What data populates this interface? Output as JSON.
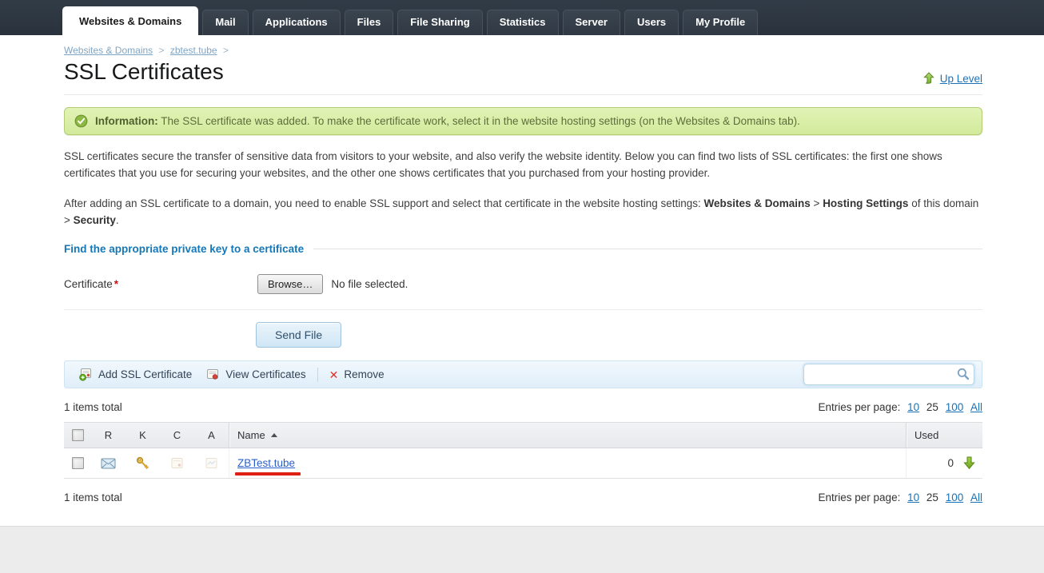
{
  "nav": {
    "tabs": [
      {
        "label": "Websites & Domains",
        "active": true
      },
      {
        "label": "Mail",
        "active": false
      },
      {
        "label": "Applications",
        "active": false
      },
      {
        "label": "Files",
        "active": false
      },
      {
        "label": "File Sharing",
        "active": false
      },
      {
        "label": "Statistics",
        "active": false
      },
      {
        "label": "Server",
        "active": false
      },
      {
        "label": "Users",
        "active": false
      },
      {
        "label": "My Profile",
        "active": false
      }
    ]
  },
  "breadcrumb": {
    "link1": "Websites & Domains",
    "link2": "zbtest.tube",
    "separator": ">"
  },
  "header": {
    "title": "SSL Certificates",
    "up_level_label": "Up Level"
  },
  "banner": {
    "label": "Information:",
    "text": "The SSL certificate was added. To make the certificate work, select it in the website hosting settings (on the Websites & Domains tab)."
  },
  "intro": {
    "p1": "SSL certificates secure the transfer of sensitive data from visitors to your website, and also verify the website identity. Below you can find two lists of SSL certificates: the first one shows certificates that you use for securing your websites, and the other one shows certificates that you purchased from your hosting provider.",
    "p2": {
      "pre": "After adding an SSL certificate to a domain, you need to enable SSL support and select that certificate in the website hosting settings: ",
      "bold1": "Websites & Domains",
      "mid1": " > ",
      "bold2": "Hosting Settings",
      "mid2": " of this domain > ",
      "bold3": "Security",
      "end": "."
    }
  },
  "form": {
    "section_title": "Find the appropriate private key to a certificate",
    "certificate_label": "Certificate",
    "required_mark": "*",
    "browse_label": "Browse…",
    "no_file": "No file selected.",
    "send_file": "Send File"
  },
  "toolbar": {
    "add_label": "Add SSL Certificate",
    "view_label": "View Certificates",
    "remove_label": "Remove",
    "search_value": ""
  },
  "glyphs": {
    "remove_x": "✕"
  },
  "list": {
    "items_total": "1 items total",
    "pager_label": "Entries per page:",
    "pager": [
      {
        "label": "10",
        "link": true
      },
      {
        "label": "25",
        "link": false
      },
      {
        "label": "100",
        "link": true
      },
      {
        "label": "All",
        "link": true
      }
    ]
  },
  "table": {
    "columns": {
      "r": "R",
      "k": "K",
      "c": "C",
      "a": "A",
      "name": "Name",
      "used": "Used"
    },
    "rows": [
      {
        "name": "ZBTest.tube",
        "used": "0"
      }
    ]
  },
  "colors": {
    "nav_bg": "#2e3742",
    "accent_link": "#1577b6",
    "banner_bg": "#daeea6",
    "banner_border": "#b4cc74",
    "row_link": "#2a5fc8",
    "marker_red": "#e01f14",
    "arrow_green": "#79b02c",
    "toolbar_bg": "#e8f3fb"
  }
}
